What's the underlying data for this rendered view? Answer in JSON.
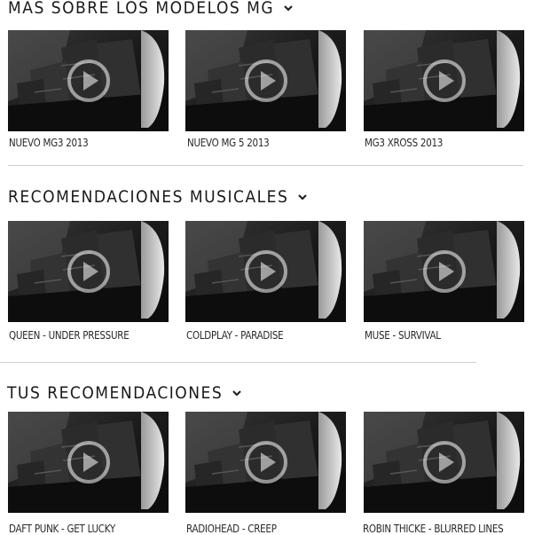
{
  "sections": [
    {
      "title": "MAS SOBRE LOS MODELOS MG",
      "items": [
        {
          "caption": "NUEVO MG3 2013"
        },
        {
          "caption": "NUEVO MG 5 2013"
        },
        {
          "caption": "MG3 XROSS 2013"
        }
      ]
    },
    {
      "title": "RECOMENDACIONES MUSICALES",
      "items": [
        {
          "caption": "QUEEN - UNDER PRESSURE"
        },
        {
          "caption": "COLDPLAY - PARADISE"
        },
        {
          "caption": "MUSE - SURVIVAL"
        }
      ]
    },
    {
      "title": "TUS RECOMENDACIONES",
      "items": [
        {
          "caption": "DAFT PUNK - GET LUCKY"
        },
        {
          "caption": "RADIOHEAD - CREEP"
        },
        {
          "caption": "ROBIN THICKE - BLURRED LINES"
        }
      ]
    }
  ],
  "icons": {
    "chevron": "chevron-down-icon",
    "play": "play-icon"
  }
}
